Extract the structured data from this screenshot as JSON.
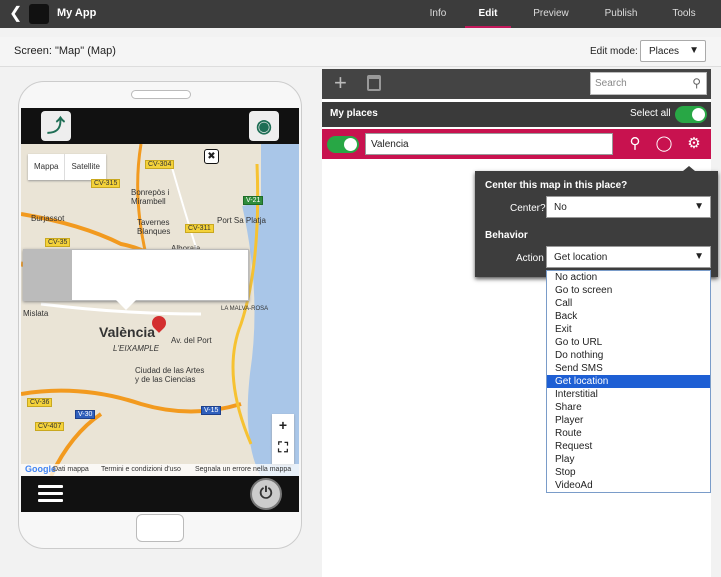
{
  "app": {
    "back_icon": "chevron-left-icon",
    "name": "My App"
  },
  "tabs": [
    {
      "label": "Info"
    },
    {
      "label": "Edit",
      "active": true
    },
    {
      "label": "Preview"
    },
    {
      "label": "Publish"
    },
    {
      "label": "Tools"
    }
  ],
  "screen": {
    "title": "Screen: \"Map\" (Map)",
    "edit_mode_label": "Edit mode:",
    "edit_mode_value": "Places"
  },
  "phone": {
    "map_type_buttons": [
      "Mappa",
      "Satellite"
    ],
    "city_label": "València",
    "district_label": "L'EIXAMPLE",
    "labels": [
      "Burjassot",
      "Bonrepòs i Mirambell",
      "Tavernes Blanques",
      "Alboraia",
      "Port Sa Platja",
      "Mislata",
      "Ciudad de las Artes y de las Ciencias",
      "Av. del Port",
      "LA MALVA-ROSA"
    ],
    "roads": [
      "CV-304",
      "CV-315",
      "CV-35",
      "CV-311",
      "V-21",
      "V-30",
      "V-15",
      "CV-36",
      "CV-407"
    ],
    "map_footer": [
      "Dati mappa",
      "Termini e condizioni d'uso",
      "Segnala un errore nella mappa"
    ],
    "google_logo": "Google",
    "zoom_in": "+",
    "fullscreen_icon": "fullscreen-icon"
  },
  "panel": {
    "search_placeholder": "Search",
    "places_title": "My places",
    "select_all_label": "Select all",
    "select_all_on": true,
    "place": {
      "name": "Valencia",
      "enabled": true
    }
  },
  "popover": {
    "center_heading": "Center this map in this place?",
    "center_label": "Center?",
    "center_value": "No",
    "behavior_heading": "Behavior",
    "action_label": "Action",
    "action_value": "Get location"
  },
  "action_options": [
    "No action",
    "Go to screen",
    "Call",
    "Back",
    "Exit",
    "Go to URL",
    "Do nothing",
    "Send SMS",
    "Get location",
    "Interstitial",
    "Share",
    "Player",
    "Route",
    "Request",
    "Play",
    "Stop",
    "VideoAd"
  ],
  "action_selected_index": 8,
  "colors": {
    "accent": "#c8124f",
    "toggle": "#28a745",
    "topbar": "#3c3c3c",
    "selected": "#1e5fd4"
  }
}
